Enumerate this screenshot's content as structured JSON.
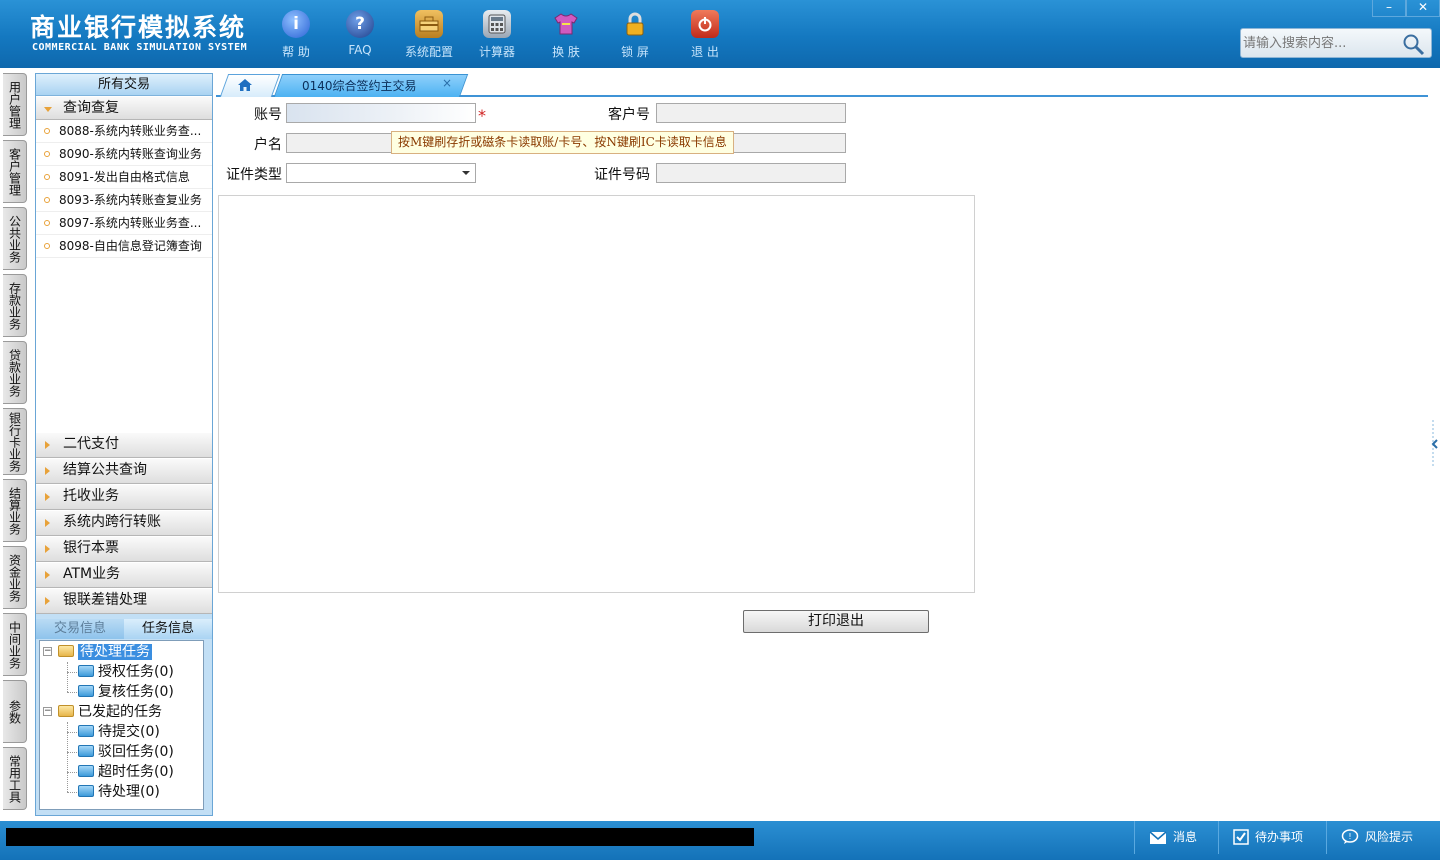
{
  "app": {
    "title_cn": "商业银行模拟系统",
    "title_en": "COMMERCIAL BANK SIMULATION SYSTEM"
  },
  "toolbar": [
    {
      "label": "帮 助",
      "icon": "info-icon",
      "color": "#3f7fe0"
    },
    {
      "label": "FAQ",
      "icon": "faq-icon",
      "color": "#2f5fb0"
    },
    {
      "label": "系统配置",
      "icon": "toolbox-icon",
      "color": "#c98a2a"
    },
    {
      "label": "计算器",
      "icon": "calculator-icon",
      "color": "#6f7f94"
    },
    {
      "label": "换 肤",
      "icon": "shirt-icon",
      "color": "#c24fb0"
    },
    {
      "label": "锁 屏",
      "icon": "lock-icon",
      "color": "#e0a12a"
    },
    {
      "label": "退 出",
      "icon": "power-icon",
      "color": "#d43a2a"
    }
  ],
  "window": {
    "minimize": "–",
    "close": "✕"
  },
  "search": {
    "placeholder": "请输入搜索内容..."
  },
  "side_tabs": [
    "用户管理",
    "客户管理",
    "公共业务",
    "存款业务",
    "贷款业务",
    "银行卡业务",
    "结算业务",
    "资金业务",
    "中间业务",
    "参数",
    "常用工具"
  ],
  "left_panel": {
    "header": "所有交易",
    "open_group": "查询查复",
    "items": [
      "8088-系统内转账业务查...",
      "8090-系统内转账查询业务",
      "8091-发出自由格式信息",
      "8093-系统内转账查复业务",
      "8097-系统内转账业务查...",
      "8098-自由信息登记簿查询"
    ],
    "groups": [
      "二代支付",
      "结算公共查询",
      "托收业务",
      "系统内跨行转账",
      "银行本票",
      "ATM业务",
      "银联差错处理"
    ],
    "sub_tabs": [
      "交易信息",
      "任务信息"
    ],
    "tree": {
      "pending": "待处理任务",
      "pending_children": [
        "授权任务(0)",
        "复核任务(0)"
      ],
      "initiated": "已发起的任务",
      "initiated_children": [
        "待提交(0)",
        "驳回任务(0)",
        "超时任务(0)",
        "待处理(0)"
      ]
    }
  },
  "main": {
    "tab_label": "0140综合签约主交易",
    "tab_close": "×",
    "form": {
      "account_label": "账号",
      "account_value": "",
      "required_mark": "*",
      "customer_no_label": "客户号",
      "name_label": "户名",
      "id_type_label": "证件类型",
      "id_no_label": "证件号码",
      "hint": "按M键刷存折或磁条卡读取账/卡号、按N键刷IC卡读取卡信息"
    },
    "print_exit": "打印退出"
  },
  "statusbar": {
    "messages": "消息",
    "todo": "待办事项",
    "risk": "风险提示"
  }
}
